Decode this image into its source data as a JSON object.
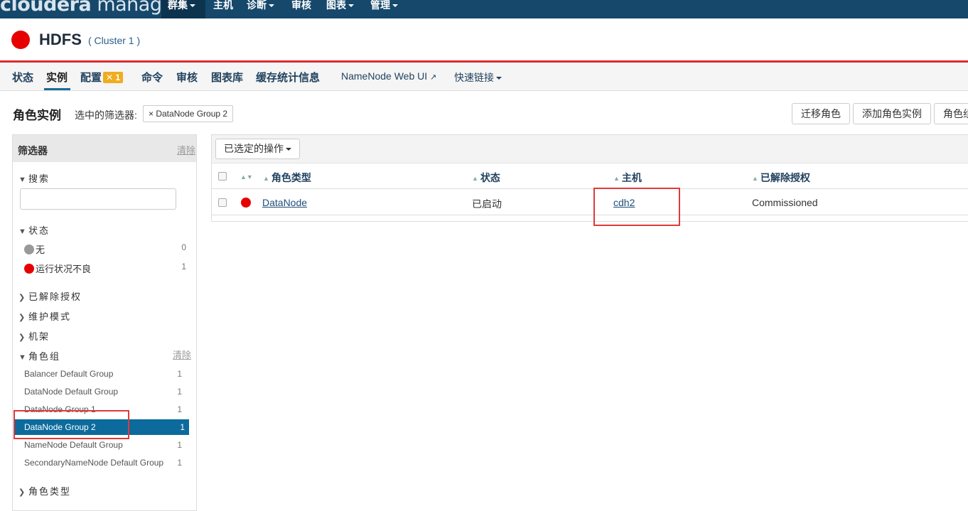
{
  "topnav": {
    "logo_a": "cloudera",
    "logo_b": "manager",
    "items": [
      {
        "label": "群集"
      },
      {
        "label": "主机"
      },
      {
        "label": "诊断"
      },
      {
        "label": "审核"
      },
      {
        "label": "图表"
      },
      {
        "label": "管理"
      }
    ]
  },
  "service": {
    "name": "HDFS",
    "cluster": "( Cluster 1 )"
  },
  "tabs": {
    "status": "状态",
    "instances": "实例",
    "config": "配置",
    "config_badge_icon": "✕",
    "config_badge_count": "1",
    "commands": "命令",
    "audit": "审核",
    "charts": "图表库",
    "cache": "缓存统计信息",
    "namenode_ui": "NameNode Web UI",
    "namenode_ui_icon": "↗",
    "quick_links": "快速链接"
  },
  "page": {
    "title": "角色实例",
    "filter_label": "选中的筛选器:",
    "filter_chip": "× DataNode Group 2",
    "buttons": {
      "migrate": "迁移角色",
      "add": "添加角色实例",
      "groups": "角色组"
    }
  },
  "sidebar": {
    "title": "筛选器",
    "clear": "清除",
    "search_section": "搜索",
    "status_section": "状态",
    "status_items": [
      {
        "label": "无",
        "count": "0",
        "color": "#999999"
      },
      {
        "label": "运行状况不良",
        "count": "1",
        "color": "#e60000"
      }
    ],
    "decommissioned_section": "已解除授权",
    "maintenance_section": "维护模式",
    "rack_section": "机架",
    "role_group_section": "角色组",
    "role_group_clear": "清除",
    "groups": [
      {
        "label": "Balancer Default Group",
        "count": "1"
      },
      {
        "label": "DataNode Default Group",
        "count": "1"
      },
      {
        "label": "DataNode Group 1",
        "count": "1"
      },
      {
        "label": "DataNode Group 2",
        "count": "1"
      },
      {
        "label": "NameNode Default Group",
        "count": "1"
      },
      {
        "label": "SecondaryNameNode Default Group",
        "count": "1"
      }
    ],
    "role_type_section": "角色类型"
  },
  "table": {
    "actions_button": "已选定的操作",
    "columns": {
      "role_type": "角色类型",
      "status": "状态",
      "host": "主机",
      "decommission": "已解除授权"
    },
    "rows": [
      {
        "role_type": "DataNode",
        "status": "已启动",
        "host": "cdh2",
        "decommission": "Commissioned",
        "health_color": "#e60000"
      }
    ]
  }
}
